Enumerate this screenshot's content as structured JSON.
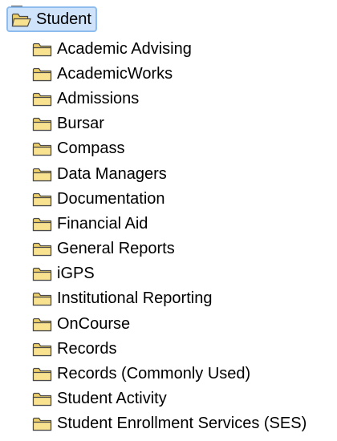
{
  "tree": {
    "root": {
      "label": "Student",
      "icon": "folder-open-icon",
      "selected": true
    },
    "children": [
      {
        "label": "Academic Advising",
        "icon": "folder-icon"
      },
      {
        "label": "AcademicWorks",
        "icon": "folder-icon"
      },
      {
        "label": "Admissions",
        "icon": "folder-icon"
      },
      {
        "label": "Bursar",
        "icon": "folder-icon"
      },
      {
        "label": "Compass",
        "icon": "folder-icon"
      },
      {
        "label": "Data Managers",
        "icon": "folder-icon"
      },
      {
        "label": "Documentation",
        "icon": "folder-icon"
      },
      {
        "label": "Financial Aid",
        "icon": "folder-icon"
      },
      {
        "label": "General Reports",
        "icon": "folder-icon"
      },
      {
        "label": "iGPS",
        "icon": "folder-icon"
      },
      {
        "label": "Institutional Reporting",
        "icon": "folder-icon"
      },
      {
        "label": "OnCourse",
        "icon": "folder-icon"
      },
      {
        "label": "Records",
        "icon": "folder-icon"
      },
      {
        "label": "Records (Commonly Used)",
        "icon": "folder-icon"
      },
      {
        "label": "Student Activity",
        "icon": "folder-icon"
      },
      {
        "label": "Student Enrollment Services (SES)",
        "icon": "folder-icon"
      }
    ],
    "colors": {
      "selection_background": "#cfe4fb",
      "selection_border": "#8fbcef",
      "folder_fill": "#f6dd85",
      "folder_outline": "#4a4a4a"
    }
  }
}
